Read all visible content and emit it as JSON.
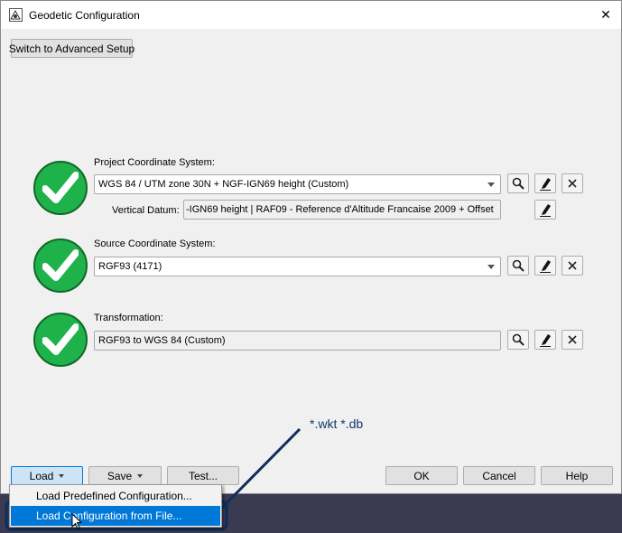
{
  "window": {
    "title": "Geodetic Configuration",
    "close_glyph": "✕"
  },
  "advanced_button": "Switch to Advanced Setup",
  "project": {
    "label": "Project Coordinate System:",
    "value": "WGS 84 / UTM zone 30N + NGF-IGN69 height (Custom)",
    "vertical_label": "Vertical Datum:",
    "vertical_value": "-IGN69 height   |   RAF09 - Reference d'Altitude Francaise 2009 + Offset"
  },
  "source": {
    "label": "Source Coordinate System:",
    "value": "RGF93 (4171)"
  },
  "transformation": {
    "label": "Transformation:",
    "value": "RGF93 to WGS 84 (Custom)"
  },
  "footer": {
    "load": "Load",
    "save": "Save",
    "test": "Test...",
    "ok": "OK",
    "cancel": "Cancel",
    "help": "Help"
  },
  "load_menu": {
    "items": [
      "Load Predefined Configuration...",
      "Load Configuration from File..."
    ],
    "selected_index": 1
  },
  "annotation": "*.wkt *.db",
  "colors": {
    "check": "#1fb14a",
    "selection": "#0078d7",
    "annotation": "#10386b"
  },
  "icons": [
    "geodetic-app-icon",
    "check-icon",
    "search-icon",
    "edit-icon",
    "clear-icon",
    "mouse-cursor-icon"
  ]
}
